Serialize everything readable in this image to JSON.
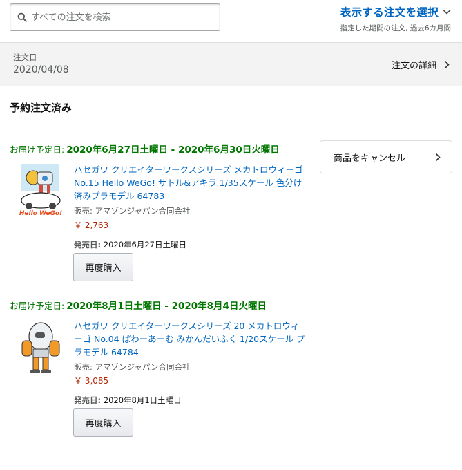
{
  "search": {
    "placeholder": "すべての注文を検索",
    "value": ""
  },
  "filter": {
    "title": "表示する注文を選択",
    "subtitle": "指定した期間の注文, 過去6カ月間"
  },
  "order": {
    "date_label": "注文日",
    "date_value": "2020/04/08",
    "details_label": "注文の詳細"
  },
  "status": "予約注文済み",
  "cancel_label": "商品をキャンセル",
  "colors": {
    "link": "#0066c0",
    "delivery_green": "#007600",
    "price_red": "#b12704"
  },
  "items": [
    {
      "delivery_label": "お届け予定日:",
      "delivery_date": "2020年6月27日土曜日 - 2020年6月30日火曜日",
      "title": "ハセガワ クリエイターワークスシリーズ メカトロウィーゴ No.15 Hello WeGo! サトル&アキラ 1/35スケール 色分け済みプラモデル 64783",
      "seller": "販売: アマゾンジャパン合同会社",
      "price": "￥ 2,763",
      "release_label": "発売日:",
      "release_date": "2020年6月27日土曜日",
      "buy_again": "再度購入",
      "thumb_logo": "Hello WeGo!"
    },
    {
      "delivery_label": "お届け予定日:",
      "delivery_date": "2020年8月1日土曜日 - 2020年8月4日火曜日",
      "title": "ハセガワ クリエイターワークスシリーズ 20 メカトロウィーゴ No.04 ぱわーあーむ みかんだいふく 1/20スケール プラモデル 64784",
      "seller": "販売: アマゾンジャパン合同会社",
      "price": "￥ 3,085",
      "release_label": "発売日:",
      "release_date": "2020年8月1日土曜日",
      "buy_again": "再度購入"
    }
  ]
}
